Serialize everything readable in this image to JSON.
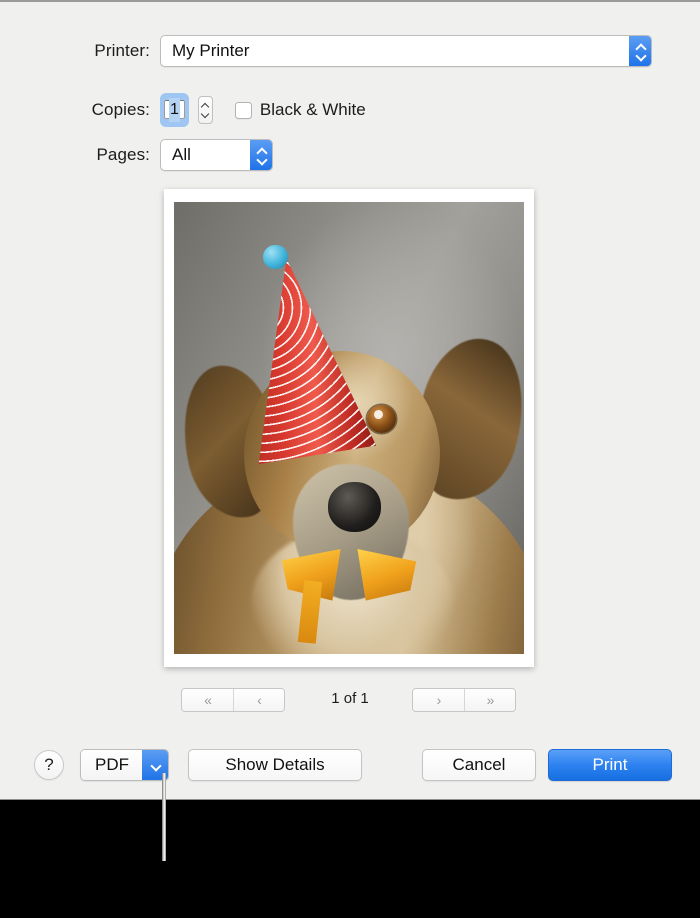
{
  "dialog": {
    "printer": {
      "label": "Printer:",
      "value": "My Printer"
    },
    "copies": {
      "label": "Copies:",
      "value": "1",
      "stepper_icon": "stepper-up-down-icon"
    },
    "black_and_white": {
      "label": "Black & White",
      "checked": false
    },
    "pages": {
      "label": "Pages:",
      "value": "All"
    }
  },
  "preview": {
    "photo_alt": "Dog wearing a red polka-dot party hat with a blue pom-pom and a yellow ribbon bow",
    "nav": {
      "first_label": "«",
      "prev_label": "‹",
      "next_label": "›",
      "last_label": "»",
      "page_indicator": "1 of 1"
    }
  },
  "bottom_bar": {
    "help_label": "?",
    "pdf_label": "PDF",
    "show_details_label": "Show Details",
    "cancel_label": "Cancel",
    "print_label": "Print"
  },
  "colors": {
    "accent_blue": "#1f73e8",
    "print_button_blue": "#2f83f1",
    "dialog_background": "#f0f0ef",
    "focus_ring": "#9fc6f2",
    "selection_blue": "#b4d2f2",
    "callout_line": "#d7d7d7",
    "backdrop": "#000000"
  }
}
